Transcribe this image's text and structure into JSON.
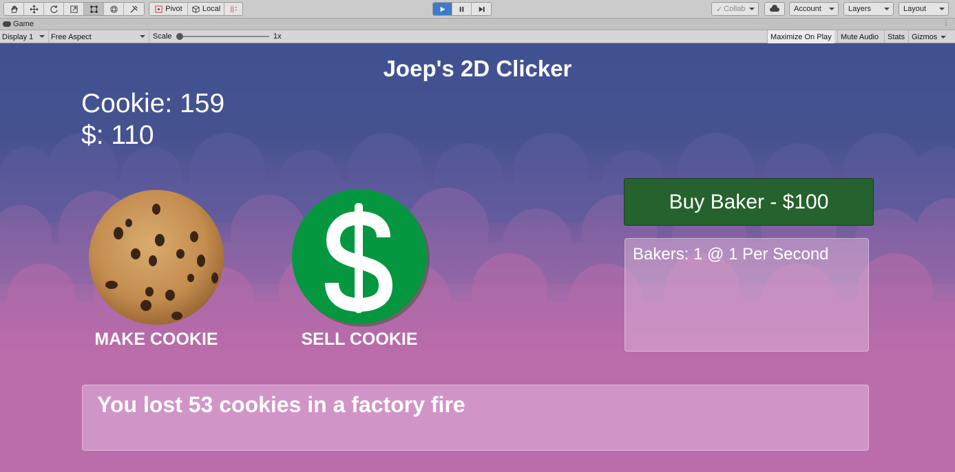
{
  "toolbar": {
    "tools": [
      "hand-tool-icon",
      "move-tool-icon",
      "rotate-tool-icon",
      "scale-tool-icon",
      "rect-tool-icon",
      "transform-tool-icon",
      "custom-tool-icon"
    ],
    "pivot_label": "Pivot",
    "local_label": "Local",
    "collab_label": "Collab",
    "account_label": "Account",
    "layers_label": "Layers",
    "layout_label": "Layout",
    "play_color": "#3d7bc8"
  },
  "tab": {
    "label": "Game"
  },
  "gamebar": {
    "display_label": "Display 1",
    "aspect_label": "Free Aspect",
    "scale_label": "Scale",
    "scale_value": "1x",
    "maximize_label": "Maximize On Play",
    "mute_label": "Mute Audio",
    "stats_label": "Stats",
    "gizmos_label": "Gizmos"
  },
  "game": {
    "title": "Joep's 2D Clicker",
    "cookie_stat": "Cookie: 159",
    "money_stat": "$: 110",
    "make_label": "MAKE COOKIE",
    "sell_label": "SELL COOKIE",
    "buy_label": "Buy Baker - $100",
    "bakers_info": "Bakers: 1 @ 1 Per Second",
    "event_message": "You lost 53 cookies in a factory fire",
    "buy_color": "#26622d",
    "money_color": "#05973f",
    "sky_color": "#3f5193",
    "ground_color": "#c46fab"
  }
}
